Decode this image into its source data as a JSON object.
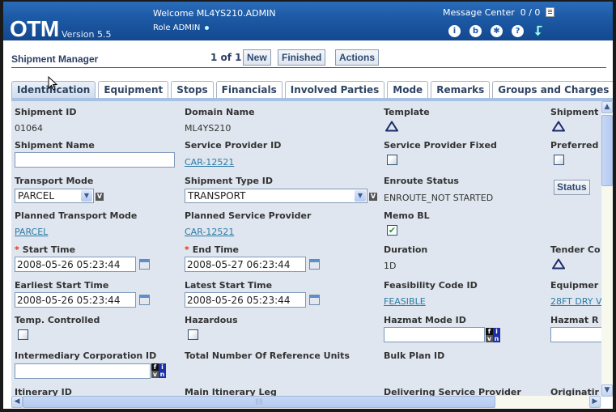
{
  "header": {
    "logo": "OTM",
    "version": "Version 5.5",
    "welcome": "Welcome ML4YS210.ADMIN",
    "role": "Role ADMIN",
    "message_center": "Message Center",
    "message_count": "0 / 0",
    "icons": [
      "info-icon",
      "bookmark-icon",
      "preferences-icon",
      "help-icon",
      "logout-arrow-icon"
    ]
  },
  "titlebar": {
    "title": "Shipment Manager",
    "pager": "1 of 1",
    "buttons": {
      "new": "New",
      "finished": "Finished",
      "actions": "Actions"
    }
  },
  "tabs": [
    {
      "label": "Identification",
      "active": true
    },
    {
      "label": "Equipment"
    },
    {
      "label": "Stops"
    },
    {
      "label": "Financials"
    },
    {
      "label": "Involved Parties"
    },
    {
      "label": "Mode"
    },
    {
      "label": "Remarks"
    },
    {
      "label": "Groups and Charges"
    }
  ],
  "form": {
    "shipment_id": {
      "label": "Shipment ID",
      "value": "01064"
    },
    "domain_name": {
      "label": "Domain Name",
      "value": "ML4YS210"
    },
    "template": {
      "label": "Template"
    },
    "shipment_col4": {
      "label": "Shipment"
    },
    "shipment_name": {
      "label": "Shipment Name",
      "value": ""
    },
    "service_provider_id": {
      "label": "Service Provider ID",
      "value": "CAR-12521"
    },
    "service_provider_fixed": {
      "label": "Service Provider Fixed",
      "checked": false
    },
    "preferred": {
      "label": "Preferred",
      "checked": false
    },
    "transport_mode": {
      "label": "Transport Mode",
      "value": "PARCEL"
    },
    "shipment_type_id": {
      "label": "Shipment Type ID",
      "value": "TRANSPORT"
    },
    "enroute_status": {
      "label": "Enroute Status",
      "value": "ENROUTE_NOT STARTED"
    },
    "status_button": "Status",
    "planned_transport_mode": {
      "label": "Planned Transport Mode",
      "value": "PARCEL"
    },
    "planned_service_provider": {
      "label": "Planned Service Provider",
      "value": "CAR-12521"
    },
    "memo_bl": {
      "label": "Memo BL",
      "checked": true
    },
    "start_time": {
      "label": "Start Time",
      "required": "*",
      "value": "2008-05-26 05:23:44"
    },
    "end_time": {
      "label": "End Time",
      "required": "*",
      "value": "2008-05-27 06:23:44"
    },
    "duration": {
      "label": "Duration",
      "value": "1D"
    },
    "tender_co": {
      "label": "Tender Co"
    },
    "earliest_start_time": {
      "label": "Earliest Start Time",
      "value": "2008-05-26 05:23:44"
    },
    "latest_start_time": {
      "label": "Latest Start Time",
      "value": "2008-05-26 05:23:44"
    },
    "feasibility_code_id": {
      "label": "Feasibility Code ID",
      "value": "FEASIBLE"
    },
    "equipment": {
      "label": "Equipmer",
      "value": "28FT DRY V"
    },
    "temp_controlled": {
      "label": "Temp. Controlled",
      "checked": false
    },
    "hazardous": {
      "label": "Hazardous",
      "checked": false
    },
    "hazmat_mode_id": {
      "label": "Hazmat Mode ID",
      "value": ""
    },
    "hazmat_r": {
      "label": "Hazmat R",
      "value": ""
    },
    "intermediary_corporation_id": {
      "label": "Intermediary Corporation ID",
      "value": ""
    },
    "total_reference_units": {
      "label": "Total Number Of Reference Units"
    },
    "bulk_plan_id": {
      "label": "Bulk Plan ID"
    },
    "itinerary_id": {
      "label": "Itinerary ID"
    },
    "main_itinerary_leg": {
      "label": "Main Itinerary Leg"
    },
    "delivering_service_provider": {
      "label": "Delivering Service Provider"
    },
    "originating": {
      "label": "Originatir"
    }
  },
  "lookup_icon_letters": {
    "f": "f",
    "i": "i",
    "v": "v",
    "n": "n"
  },
  "select_badge": "V",
  "colors": {
    "header_blue": "#1d5aa6",
    "panel_bg": "#dfe6ef",
    "link": "#2d7ba5",
    "required": "#e03a1a"
  }
}
